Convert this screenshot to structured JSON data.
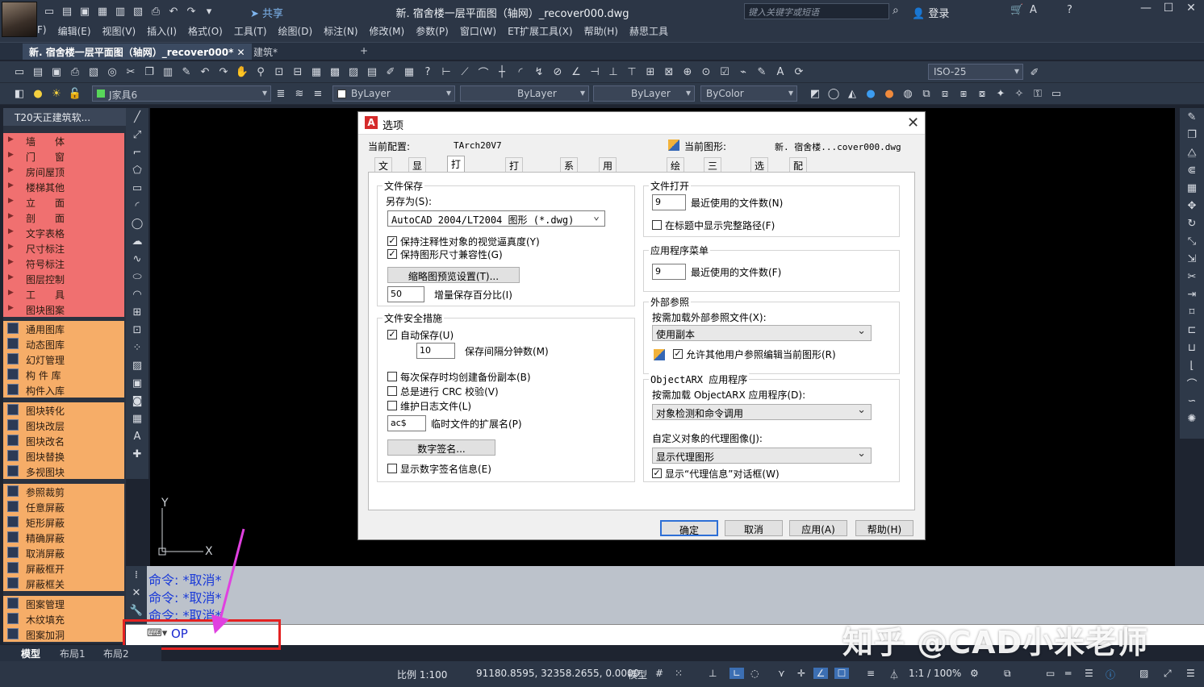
{
  "app": {
    "share_label": "共享",
    "window_title": "新. 宿舍楼一层平面图（轴网）_recover000.dwg",
    "search_placeholder": "键入关键字或短语",
    "login_label": "登录"
  },
  "menu": [
    "F)",
    "编辑(E)",
    "视图(V)",
    "插入(I)",
    "格式(O)",
    "工具(T)",
    "绘图(D)",
    "标注(N)",
    "修改(M)",
    "参数(P)",
    "窗口(W)",
    "ET扩展工具(X)",
    "帮助(H)",
    "赫思工具"
  ],
  "doc_tabs": {
    "active": "新. 宿舍楼一层平面图（轴网）_recover000*",
    "second": "建筑*",
    "add": "+"
  },
  "toolbar": {
    "dimstyle": "ISO-25",
    "layer": "J家具6",
    "color": "ByLayer",
    "linetype": "ByLayer",
    "lineweight": "ByLayer",
    "plotstyle": "ByColor"
  },
  "palette": {
    "title": "T20天正建筑软...",
    "red_items": [
      "墙　　体",
      "门　　窗",
      "房间屋顶",
      "楼梯其他",
      "立　　面",
      "剖　　面",
      "文字表格",
      "尺寸标注",
      "符号标注",
      "图层控制",
      "工　　具",
      "图块图案"
    ],
    "group1": [
      "通用图库",
      "动态图库",
      "幻灯管理",
      "构 件 库",
      "构件入库"
    ],
    "group2": [
      "图块转化",
      "图块改层",
      "图块改名",
      "图块替换",
      "多视图块"
    ],
    "group3": [
      "参照裁剪",
      "任意屏蔽",
      "矩形屏蔽",
      "精确屏蔽",
      "取消屏蔽",
      "屏蔽框开",
      "屏蔽框关"
    ],
    "group4": [
      "图案管理",
      "木纹填充",
      "图案加洞"
    ]
  },
  "ucs": {
    "x_label": "X",
    "y_label": "Y"
  },
  "command": {
    "history": [
      "命令: *取消*",
      "命令: *取消*",
      "命令: *取消*"
    ],
    "input": "OP",
    "watermark": "知乎 @CAD小米老师"
  },
  "layout_tabs": [
    "模型",
    "布局1",
    "布局2"
  ],
  "status": {
    "scale": "比例 1:100",
    "coords": "91180.8595, 32358.2655, 0.0000",
    "space": "模型",
    "anno": "1:1 / 100%"
  },
  "dialog": {
    "title": "选项",
    "current_profile_label": "当前配置:",
    "current_profile": "TArch20V7",
    "current_drawing_label": "当前图形:",
    "current_drawing": "新. 宿舍楼...cover000.dwg",
    "tabs": [
      "文件",
      "显示",
      "打开和保存",
      "打印和发布",
      "系统",
      "用户系统配置",
      "绘图",
      "三维建模",
      "选择集",
      "配置"
    ],
    "file_save": {
      "title": "文件保存",
      "save_as_label": "另存为(S):",
      "save_as_value": "AutoCAD 2004/LT2004 图形 (*.dwg)",
      "keep_visual": "保持注释性对象的视觉逼真度(Y)",
      "keep_size": "保持图形尺寸兼容性(G)",
      "thumb_btn": "缩略图预览设置(T)...",
      "incr_value": "50",
      "incr_label": "增量保存百分比(I)"
    },
    "file_safety": {
      "title": "文件安全措施",
      "autosave": "自动保存(U)",
      "interval_value": "10",
      "interval_label": "保存间隔分钟数(M)",
      "backup": "每次保存时均创建备份副本(B)",
      "crc": "总是进行 CRC 校验(V)",
      "log": "维护日志文件(L)",
      "ext_value": "ac$",
      "ext_label": "临时文件的扩展名(P)",
      "sig_btn": "数字签名...",
      "sig_info": "显示数字签名信息(E)"
    },
    "file_open": {
      "title": "文件打开",
      "recent_value": "9",
      "recent_label": "最近使用的文件数(N)",
      "full_path": "在标题中显示完整路径(F)"
    },
    "app_menu": {
      "title": "应用程序菜单",
      "recent_value": "9",
      "recent_label": "最近使用的文件数(F)"
    },
    "xref": {
      "title": "外部参照",
      "demand_label": "按需加载外部参照文件(X):",
      "demand_value": "使用副本",
      "allow": "允许其他用户参照编辑当前图形(R)"
    },
    "objectarx": {
      "title": "ObjectARX 应用程序",
      "demand_label": "按需加载 ObjectARX 应用程序(D):",
      "demand_value": "对象检测和命令调用",
      "proxy_label": "自定义对象的代理图像(J):",
      "proxy_value": "显示代理图形",
      "proxy_info": "显示“代理信息”对话框(W)"
    },
    "buttons": {
      "ok": "确定",
      "cancel": "取消",
      "apply": "应用(A)",
      "help": "帮助(H)"
    }
  }
}
